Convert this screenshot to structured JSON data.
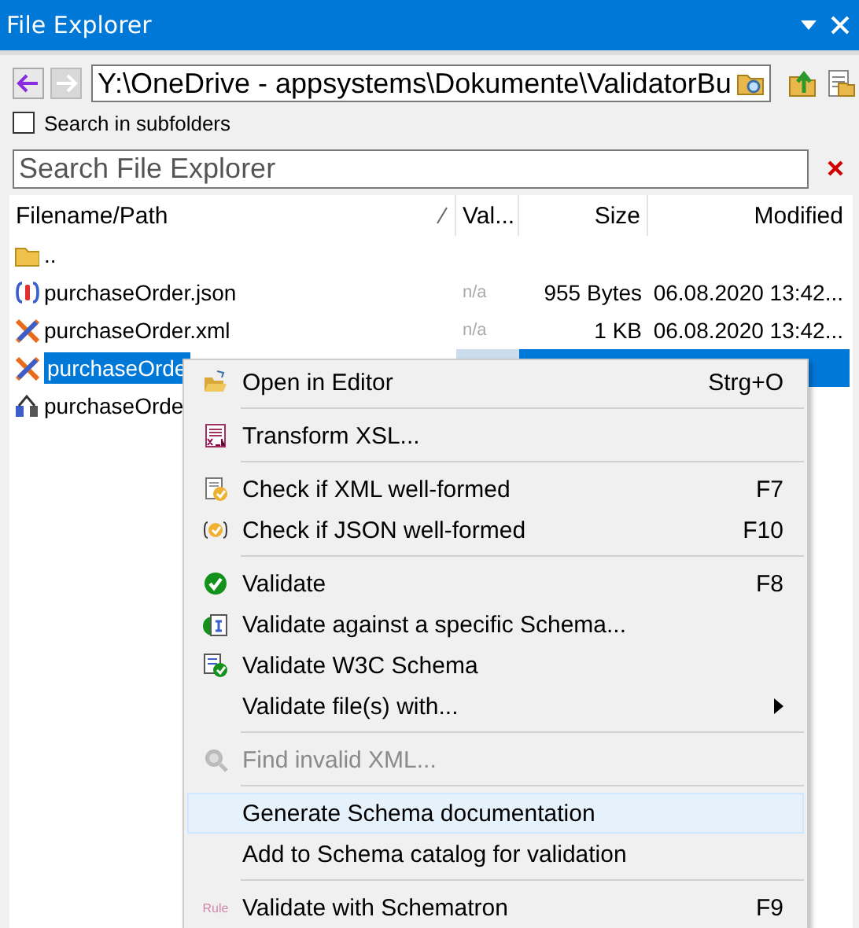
{
  "window": {
    "title": "File Explorer"
  },
  "path": {
    "value": "Y:\\OneDrive - appsystems\\Dokumente\\ValidatorBu"
  },
  "search_in_subfolders": {
    "label": "Search in subfolders",
    "checked": false
  },
  "search": {
    "placeholder": "Search File Explorer"
  },
  "table": {
    "columns": [
      {
        "label": "Filename/Path"
      },
      {
        "label": "Val..."
      },
      {
        "label": "Size"
      },
      {
        "label": "Modified"
      }
    ],
    "rows": [
      {
        "kind": "folder",
        "name": "..",
        "selected": false
      },
      {
        "kind": "json",
        "name": "purchaseOrder.json",
        "valid": "n/a",
        "size": "955 Bytes",
        "modified": "06.08.2020 13:42...",
        "selected": false
      },
      {
        "kind": "xml",
        "name": "purchaseOrder.xml",
        "valid": "n/a",
        "size": "1 KB",
        "modified": "06.08.2020 13:42...",
        "selected": false
      },
      {
        "kind": "xml",
        "name": "purchaseOrde",
        "selected": true
      },
      {
        "kind": "schema",
        "name": "purchaseOrde",
        "selected": false
      }
    ]
  },
  "context_menu": {
    "items": [
      {
        "kind": "item",
        "label": "Open in Editor",
        "shortcut": "Strg+O",
        "disabled": false,
        "highlighted": false
      },
      {
        "kind": "separator"
      },
      {
        "kind": "item",
        "label": "Transform XSL...",
        "disabled": false,
        "highlighted": false
      },
      {
        "kind": "separator"
      },
      {
        "kind": "item",
        "label": "Check if XML well-formed",
        "shortcut": "F7",
        "disabled": false,
        "highlighted": false
      },
      {
        "kind": "item",
        "label": "Check if JSON well-formed",
        "shortcut": "F10",
        "disabled": false,
        "highlighted": false
      },
      {
        "kind": "separator"
      },
      {
        "kind": "item",
        "label": "Validate",
        "shortcut": "F8",
        "disabled": false,
        "highlighted": false
      },
      {
        "kind": "item",
        "label": "Validate against a specific Schema...",
        "disabled": false,
        "highlighted": false
      },
      {
        "kind": "item",
        "label": "Validate W3C Schema",
        "disabled": false,
        "highlighted": false
      },
      {
        "kind": "item",
        "label": "Validate file(s) with...",
        "submenu": true,
        "disabled": false,
        "highlighted": false
      },
      {
        "kind": "separator"
      },
      {
        "kind": "item",
        "label": "Find invalid XML...",
        "disabled": true,
        "highlighted": false
      },
      {
        "kind": "separator"
      },
      {
        "kind": "item",
        "label": "Generate Schema documentation",
        "disabled": false,
        "highlighted": true
      },
      {
        "kind": "item",
        "label": "Add to Schema catalog for validation",
        "disabled": false,
        "highlighted": false
      },
      {
        "kind": "separator"
      },
      {
        "kind": "item",
        "icon_text": "Rule",
        "label": "Validate with Schematron",
        "shortcut": "F9",
        "disabled": false,
        "highlighted": false
      }
    ]
  }
}
